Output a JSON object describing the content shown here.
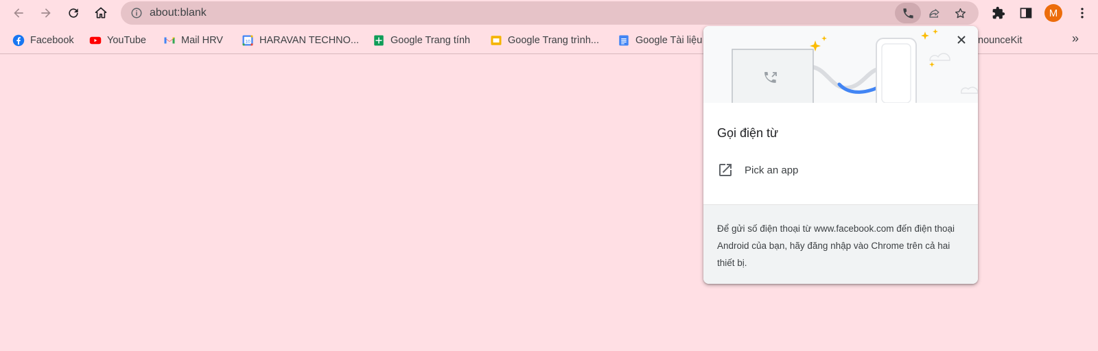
{
  "toolbar": {
    "url": "about:blank",
    "profile_initial": "M"
  },
  "bookmarks": [
    {
      "label": "Facebook",
      "icon": "facebook-icon"
    },
    {
      "label": "YouTube",
      "icon": "youtube-icon"
    },
    {
      "label": "Mail HRV",
      "icon": "gmail-icon"
    },
    {
      "label": "HARAVAN TECHNO...",
      "icon": "calendar-icon"
    },
    {
      "label": "Google Trang tính",
      "icon": "sheets-icon"
    },
    {
      "label": "Google Trang trình...",
      "icon": "slides-icon"
    },
    {
      "label": "Google Tài liệu",
      "icon": "docs-icon"
    },
    {
      "label": "nounceKit",
      "icon": ""
    }
  ],
  "bookmarks_more": "»",
  "popup": {
    "title": "Gọi điện từ",
    "pick_app_label": "Pick an app",
    "footer_text": "Để gửi số điện thoại từ www.facebook.com đến điện thoại Android của bạn, hãy đăng nhập vào Chrome trên cả hai thiết bị.",
    "close_glyph": "✕"
  },
  "colors": {
    "page_bg": "#ffdfe4",
    "omnibox_bg": "#e6c3c8",
    "avatar": "#ec6c0b",
    "accent_blue": "#4285f4"
  }
}
